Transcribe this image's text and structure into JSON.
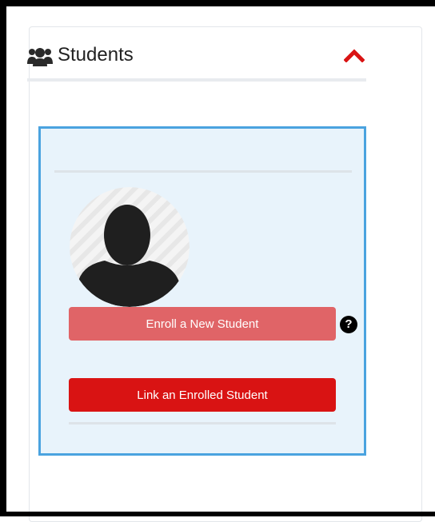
{
  "section": {
    "title": "Students",
    "icon": "users-icon",
    "collapse_icon": "chevron-up-icon"
  },
  "student_panel": {
    "avatar_icon": "user-silhouette-icon",
    "enroll_label": "Enroll a New Student",
    "help_label": "?",
    "link_label": "Link an Enrolled Student"
  },
  "colors": {
    "accent": "#d91313",
    "enroll_button": "#e06467",
    "panel_border": "#4aa3df",
    "panel_background": "#e8f3fb"
  }
}
